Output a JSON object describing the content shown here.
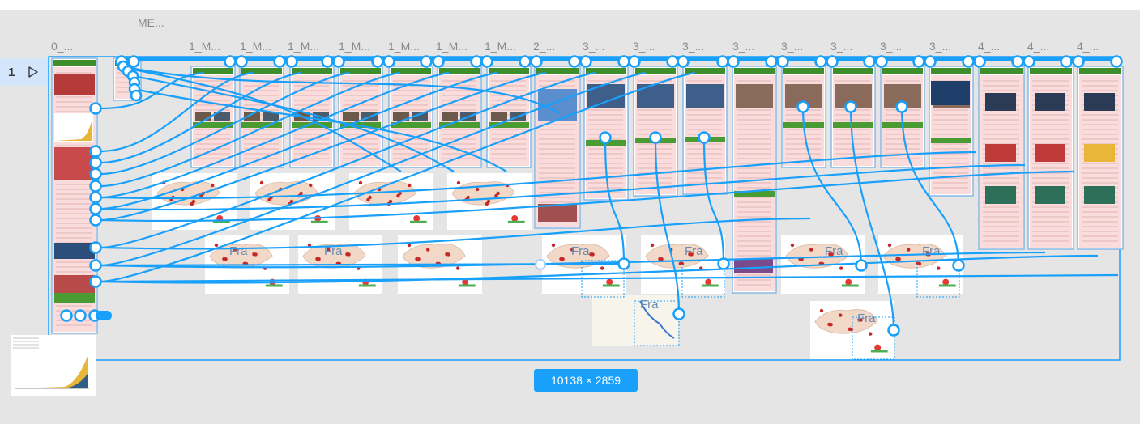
{
  "canvas": {
    "background": "#e5e5e5",
    "accent": "#18a0fb"
  },
  "page": {
    "number": "1",
    "play_icon": "play-icon"
  },
  "frames": [
    {
      "label": "0_..."
    },
    {
      "label": "ME..."
    },
    {
      "label": "1_M..."
    },
    {
      "label": "1_M..."
    },
    {
      "label": "1_M..."
    },
    {
      "label": "1_M..."
    },
    {
      "label": "1_M..."
    },
    {
      "label": "1_M..."
    },
    {
      "label": "1_M..."
    },
    {
      "label": "2_..."
    },
    {
      "label": "3_..."
    },
    {
      "label": "3_..."
    },
    {
      "label": "3_..."
    },
    {
      "label": "3_..."
    },
    {
      "label": "3_..."
    },
    {
      "label": "3_..."
    },
    {
      "label": "3_..."
    },
    {
      "label": "3_..."
    },
    {
      "label": "4_..."
    },
    {
      "label": "4_..."
    },
    {
      "label": "4_..."
    }
  ],
  "map_overlay_text": "Fra",
  "selection": {
    "dimensions": "10138 × 2859"
  }
}
